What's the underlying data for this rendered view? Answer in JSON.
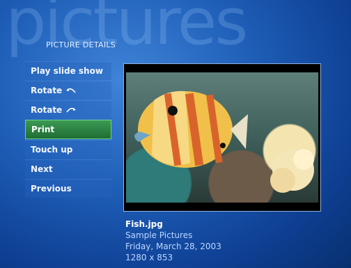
{
  "watermark": "pictures",
  "section_title": "PICTURE DETAILS",
  "menu": [
    {
      "label": "Play slide show",
      "icon": null,
      "active": false
    },
    {
      "label": "Rotate",
      "icon": "rotate-left-icon",
      "active": false
    },
    {
      "label": "Rotate",
      "icon": "rotate-right-icon",
      "active": false
    },
    {
      "label": "Print",
      "icon": null,
      "active": true
    },
    {
      "label": "Touch up",
      "icon": null,
      "active": false
    },
    {
      "label": "Next",
      "icon": null,
      "active": false
    },
    {
      "label": "Previous",
      "icon": null,
      "active": false
    }
  ],
  "photo": {
    "subject": "fish-photo"
  },
  "details": {
    "filename": "Fish.jpg",
    "folder": "Sample Pictures",
    "date": "Friday, March 28, 2003",
    "dimensions": "1280 x 853"
  },
  "colors": {
    "accent_active": "#2f8745",
    "background_center": "#3f84d8",
    "background_edge": "#08306f"
  }
}
